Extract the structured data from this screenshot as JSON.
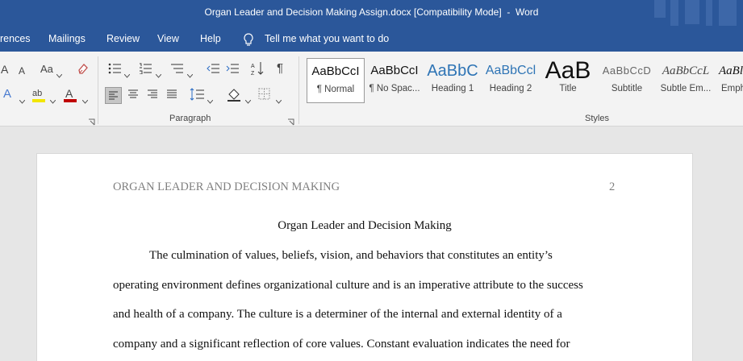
{
  "window": {
    "title": "Organ Leader and Decision Making Assign.docx [Compatibility Mode]  -  Word"
  },
  "menu": {
    "items": [
      "rences",
      "Mailings",
      "Review",
      "View",
      "Help"
    ],
    "tell_me": "Tell me what you want to do"
  },
  "ribbon": {
    "font_group": {
      "grow": "A",
      "shrink": "A",
      "case": "Aa",
      "font_color": "A",
      "text_effects": "A",
      "highlight": "ab"
    },
    "paragraph_label": "Paragraph",
    "pilcrow": "¶",
    "styles_label": "Styles",
    "styles": [
      {
        "preview": "AaBbCcI",
        "name": "¶ Normal"
      },
      {
        "preview": "AaBbCcI",
        "name": "¶ No Spac..."
      },
      {
        "preview": "AaBbC",
        "name": "Heading 1"
      },
      {
        "preview": "AaBbCcl",
        "name": "Heading 2"
      },
      {
        "preview": "AaB",
        "name": "Title"
      },
      {
        "preview": "AaBbCcD",
        "name": "Subtitle"
      },
      {
        "preview": "AaBbCcL",
        "name": "Subtle Em..."
      },
      {
        "preview": "AaBl",
        "name": "Emph"
      }
    ]
  },
  "document": {
    "header_text": "ORGAN LEADER AND DECISION MAKING",
    "page_number": "2",
    "title": "Organ Leader and Decision Making",
    "lines": [
      "The culmination of values, beliefs, vision, and behaviors that constitutes an entity’s",
      "operating environment defines organizational culture and is an imperative attribute to the success",
      "and health of a company. The culture is a determiner of the internal and external identity of a",
      "company and a significant reflection of core values. Constant evaluation indicates the need for"
    ]
  }
}
